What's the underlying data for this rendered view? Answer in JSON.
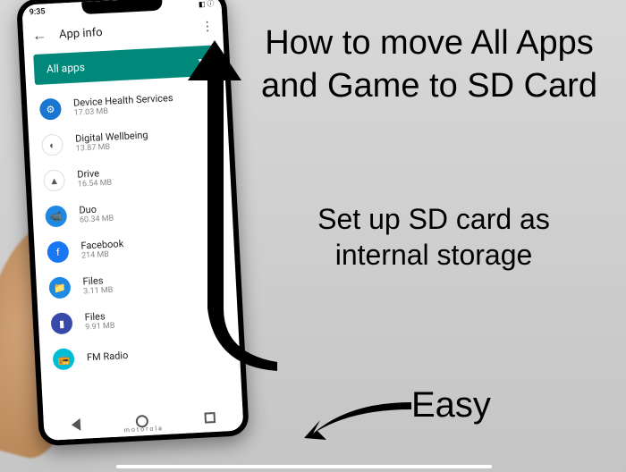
{
  "status": {
    "time": "9:35"
  },
  "header": {
    "title": "App info"
  },
  "dropdown": {
    "label": "All apps"
  },
  "apps": [
    {
      "name": "Device Health Services",
      "size": "17.03 MB",
      "color": "#1976d2",
      "glyph": "⚙"
    },
    {
      "name": "Digital Wellbeing",
      "size": "13.87 MB",
      "color": "#ffffff",
      "glyph": "◐"
    },
    {
      "name": "Drive",
      "size": "16.54 MB",
      "color": "#ffffff",
      "glyph": "▲"
    },
    {
      "name": "Duo",
      "size": "60.34 MB",
      "color": "#1e88e5",
      "glyph": "📹"
    },
    {
      "name": "Facebook",
      "size": "214 MB",
      "color": "#1877f2",
      "glyph": "f"
    },
    {
      "name": "Files",
      "size": "3.11 MB",
      "color": "#1e88e5",
      "glyph": "📁"
    },
    {
      "name": "Files",
      "size": "9.91 MB",
      "color": "#3949ab",
      "glyph": "▮"
    },
    {
      "name": "FM Radio",
      "size": "",
      "color": "#00bcd4",
      "glyph": "📻"
    }
  ],
  "overlay": {
    "line1": "How to move All Apps and Game to SD Card",
    "line2": "Set up SD card as internal storage",
    "line3": "Easy"
  },
  "brand": "motorola"
}
